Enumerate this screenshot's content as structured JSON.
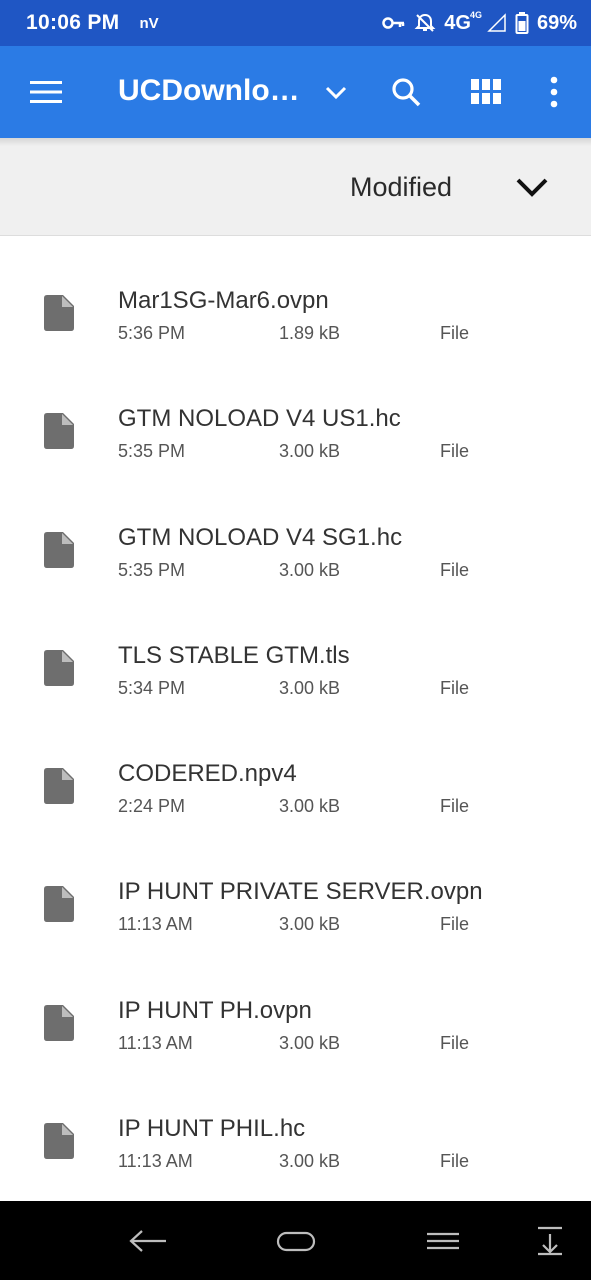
{
  "status_bar": {
    "time": "10:06 PM",
    "carrier": "nV",
    "network": "4G",
    "network_sup": "4G",
    "battery": "69%",
    "icons": [
      "vpn-key-icon",
      "bell-off-icon",
      "signal-icon",
      "battery-icon"
    ]
  },
  "app_bar": {
    "title": "UCDownlo…",
    "color": "#2b7be5",
    "icons": [
      "menu-icon",
      "chevron-down-icon",
      "search-icon",
      "grid-view-icon",
      "more-vert-icon"
    ]
  },
  "sort": {
    "label": "Modified",
    "icon": "chevron-down-icon"
  },
  "files": [
    {
      "name": "Mar1SG-Mar6.ovpn",
      "time": "5:36 PM",
      "size": "1.89 kB",
      "type": "File"
    },
    {
      "name": "GTM NOLOAD V4 US1.hc",
      "time": "5:35 PM",
      "size": "3.00 kB",
      "type": "File"
    },
    {
      "name": "GTM NOLOAD V4 SG1.hc",
      "time": "5:35 PM",
      "size": "3.00 kB",
      "type": "File"
    },
    {
      "name": "TLS STABLE GTM.tls",
      "time": "5:34 PM",
      "size": "3.00 kB",
      "type": "File"
    },
    {
      "name": "CODERED.npv4",
      "time": "2:24 PM",
      "size": "3.00 kB",
      "type": "File"
    },
    {
      "name": "IP HUNT PRIVATE SERVER.ovpn",
      "time": "11:13 AM",
      "size": "3.00 kB",
      "type": "File"
    },
    {
      "name": "IP HUNT PH.ovpn",
      "time": "11:13 AM",
      "size": "3.00 kB",
      "type": "File"
    },
    {
      "name": "IP HUNT PHIL.hc",
      "time": "11:13 AM",
      "size": "3.00 kB",
      "type": "File"
    }
  ],
  "nav_bar": {
    "icons": [
      "back-icon",
      "home-icon",
      "recents-icon",
      "notification-drawer-icon"
    ]
  }
}
